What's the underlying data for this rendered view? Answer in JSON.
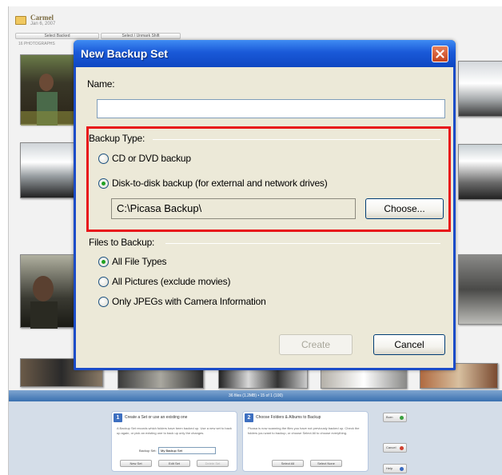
{
  "background": {
    "album_name": "Carmel",
    "album_date": "Jan 6, 2007",
    "select_button": "Select Backed",
    "deselect_button": "Select / Unmark Shift",
    "photo_count": "16 PHOTOGRAPHS",
    "status_bar": "36 files (1.2MB) • 15 of 1 (100)",
    "step1": {
      "number": "1",
      "title": "Create a Set or use an existing one",
      "body": "A Backup Set records which folders have been backed up. Use a new set to back up again, or pick an existing one to back up only the changes.",
      "set_label": "Backup Set:",
      "set_value": "My Backup Set",
      "new_set": "New Set",
      "edit_set": "Edit Set",
      "delete_set": "Delete Set"
    },
    "step2": {
      "number": "2",
      "title": "Choose Folders & Albums to Backup",
      "body": "Picasa is now scanning the files you have not previously backed up. Check the folders you want to backup, or choose Select All to choose everything.",
      "select_all": "Select All",
      "select_none": "Select None"
    },
    "side_buttons": {
      "burn": "Burn",
      "cancel": "Cancel",
      "help": "Help"
    }
  },
  "dialog": {
    "title": "New Backup Set",
    "name_label": "Name:",
    "name_value": "",
    "backup_type_label": "Backup Type:",
    "cd_dvd_option": "CD or DVD backup",
    "disk_option": "Disk-to-disk backup (for external and network drives)",
    "path_value": "C:\\Picasa Backup\\",
    "choose_button": "Choose...",
    "files_label": "Files to Backup:",
    "all_types_option": "All File Types",
    "all_pictures_option": "All Pictures (exclude movies)",
    "jpegs_option": "Only JPEGs with Camera Information",
    "create_button": "Create",
    "cancel_button": "Cancel"
  },
  "colors": {
    "title_bar": "#1a59d8",
    "dialog_face": "#ece9d8",
    "highlight": "#e8161a",
    "radio_dot": "#21a121"
  }
}
